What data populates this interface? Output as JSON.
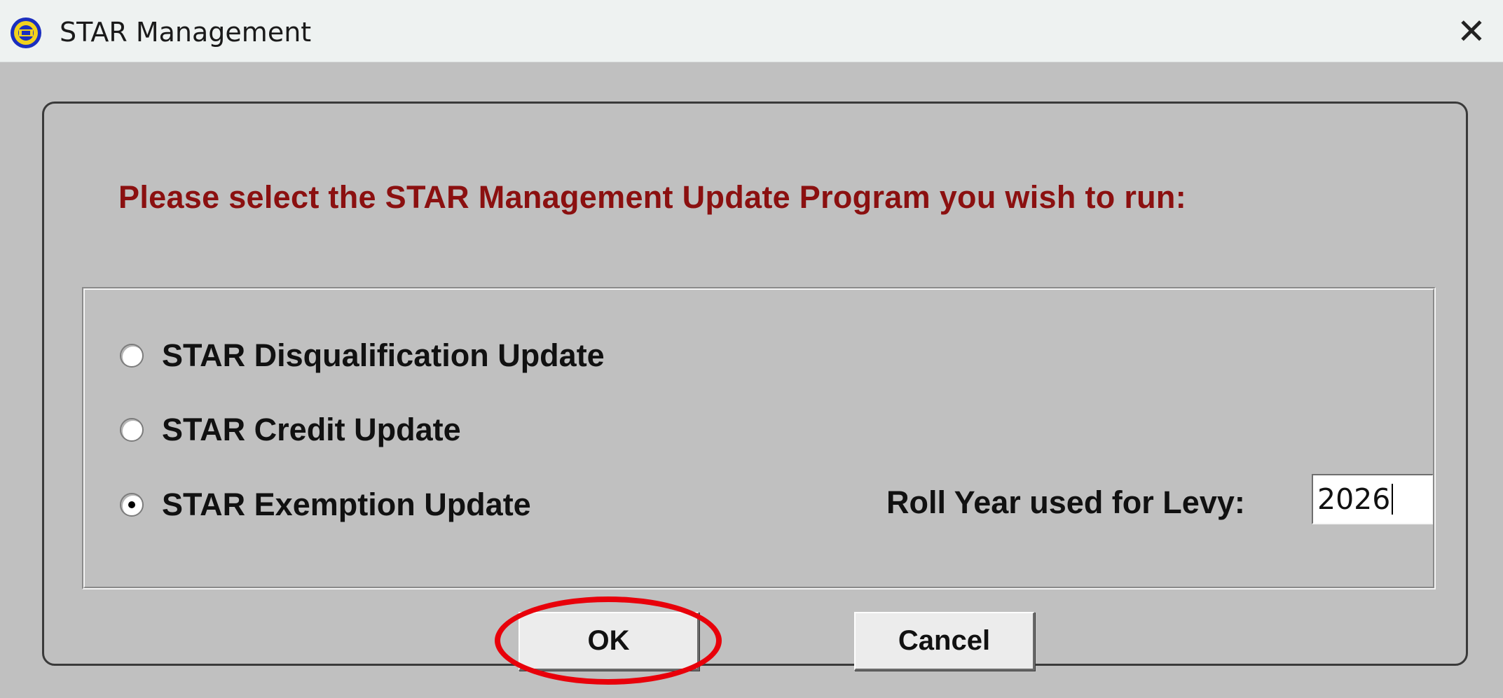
{
  "window": {
    "title": "STAR Management",
    "close_glyph": "✕",
    "icon": "app-globe-icon"
  },
  "dialog": {
    "prompt": "Please select the STAR Management Update Program you wish to run:",
    "options": [
      {
        "label": "STAR Disqualification Update",
        "selected": false
      },
      {
        "label": "STAR Credit Update",
        "selected": false
      },
      {
        "label": "STAR Exemption Update",
        "selected": true
      }
    ],
    "roll_year": {
      "label": "Roll Year used for Levy:",
      "value": "2026"
    },
    "buttons": {
      "ok": "OK",
      "cancel": "Cancel"
    }
  },
  "colors": {
    "prompt_text": "#8b1010",
    "highlight_ring": "#e8000a",
    "background": "#c0c0c0"
  }
}
